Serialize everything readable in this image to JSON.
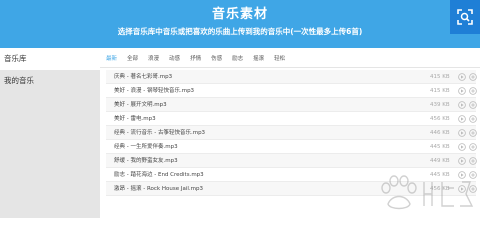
{
  "header": {
    "title": "音乐素材",
    "subtitle": "选择音乐库中音乐或把喜欢的乐曲上传到我的音乐中(一次性最多上传6首)"
  },
  "sidebar": {
    "items": [
      {
        "label": "音乐库"
      },
      {
        "label": "我的音乐"
      }
    ]
  },
  "tabs": [
    "最新",
    "全部",
    "浪漫",
    "动感",
    "抒情",
    "伤感",
    "励志",
    "摇滚",
    "轻松"
  ],
  "songs": [
    {
      "name": "庆典 - 著名七彩哥.mp3",
      "size": "415 KB"
    },
    {
      "name": "美好 - 浪漫 - 钢琴轻快音乐.mp3",
      "size": "415 KB"
    },
    {
      "name": "美好 - 展开文明.mp3",
      "size": "439 KB"
    },
    {
      "name": "美好 - 雷电.mp3",
      "size": "456 KB"
    },
    {
      "name": "经典 - 流行音乐 - 古筝轻快音乐.mp3",
      "size": "446 KB"
    },
    {
      "name": "经典 - 一生所爱伴奏.mp3",
      "size": "445 KB"
    },
    {
      "name": "舒缓 - 我的野蛮女友.mp3",
      "size": "449 KB"
    },
    {
      "name": "励志 - 踏花海边 - End Credits.mp3",
      "size": "445 KB"
    },
    {
      "name": "激昂 - 摇滚 - Rock House Jail.mp3",
      "size": "456 KB"
    }
  ],
  "icons": {
    "scan": "scan-icon",
    "play": "play-icon",
    "add": "add-icon",
    "watermark": "baidu-jingyan-logo"
  },
  "colors": {
    "header": "#3fa6e6",
    "scan_button": "#1f7fd6",
    "sidebar": "#e5e5e5",
    "active_tab": "#3fa6e6"
  }
}
